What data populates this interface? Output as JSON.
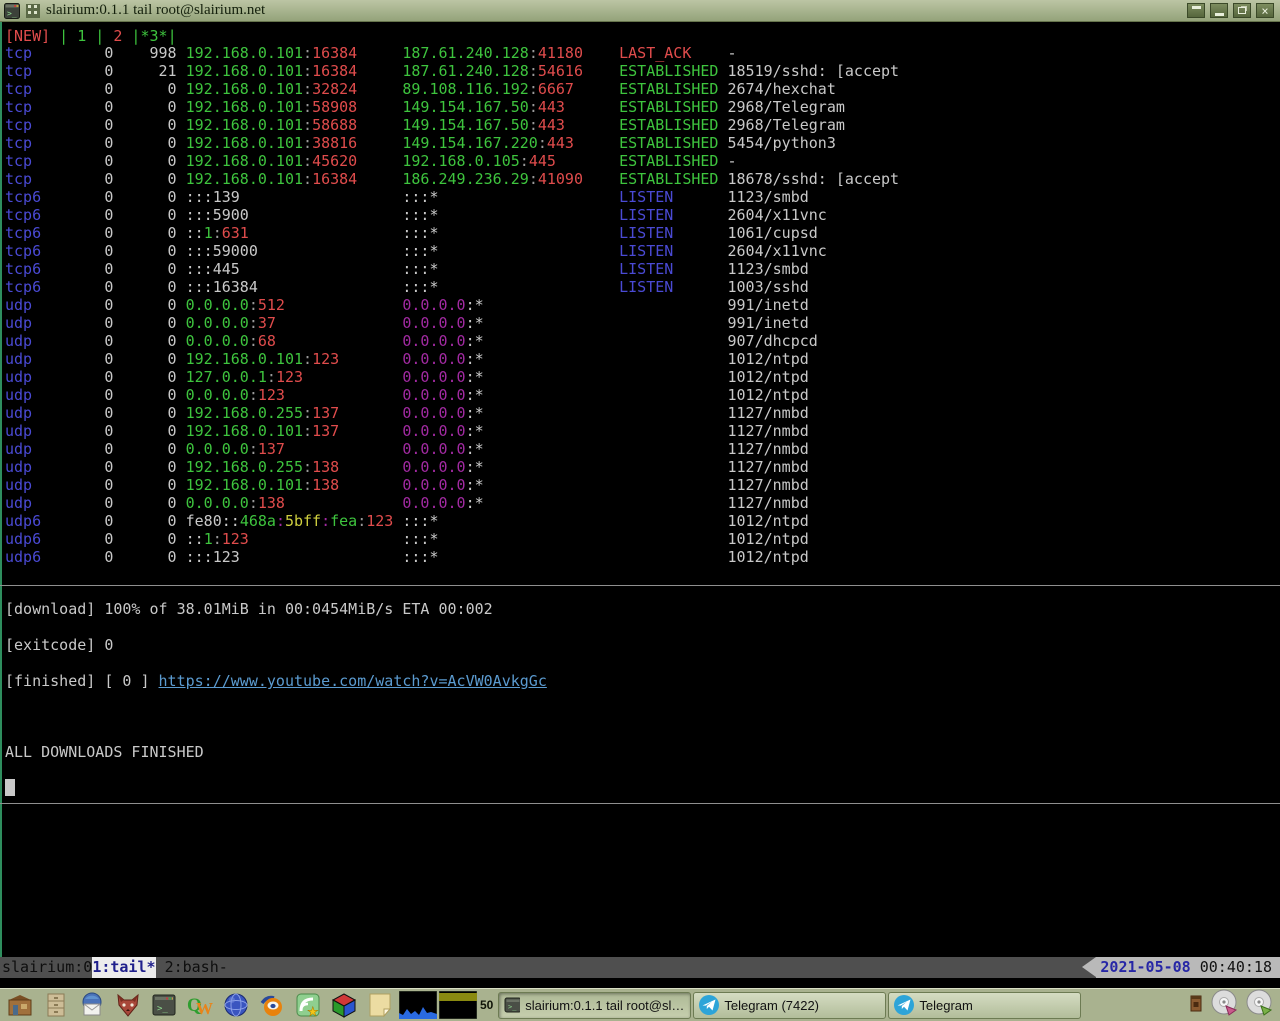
{
  "palette": {
    "blue": "#4a4ad4",
    "green": "#3ec43e",
    "red": "#e04c4c",
    "white": "#c9c9c9",
    "dim": "#9a9a9a",
    "purple": "#a22aa2",
    "yellow": "#cfcf3f",
    "link": "#5b9bd0",
    "term_bg": "#000000",
    "border_green": "#2e8e5e",
    "titlebar": "#a9b28f"
  },
  "window": {
    "title": "slairium:0.1.1 tail root@slairium.net",
    "controls": [
      {
        "name": "shade"
      },
      {
        "name": "minimize"
      },
      {
        "name": "maximize"
      },
      {
        "name": "close"
      }
    ]
  },
  "terminal": {
    "tabline": [
      {
        "t": "[NEW]",
        "c": "red"
      },
      {
        "t": " | ",
        "c": "green"
      },
      {
        "t": "1",
        "c": "green"
      },
      {
        "t": " | ",
        "c": "green"
      },
      {
        "t": "2",
        "c": "red"
      },
      {
        "t": " |",
        "c": "green"
      },
      {
        "t": "*3*",
        "c": "green"
      },
      {
        "t": "|",
        "c": "green"
      }
    ],
    "netstat": {
      "rows": [
        {
          "proto": "tcp",
          "rq": "0",
          "sq": "998",
          "local": [
            [
              "192.168.0.101",
              "green"
            ],
            [
              ":",
              "dim"
            ],
            [
              "16384",
              "red"
            ]
          ],
          "foreign": [
            [
              "187.61.240.128",
              "green"
            ],
            [
              ":",
              "dim"
            ],
            [
              "41180",
              "red"
            ]
          ],
          "state": [
            "LAST_ACK",
            "red"
          ],
          "prog": "-"
        },
        {
          "proto": "tcp",
          "rq": "0",
          "sq": "21",
          "local": [
            [
              "192.168.0.101",
              "green"
            ],
            [
              ":",
              "dim"
            ],
            [
              "16384",
              "red"
            ]
          ],
          "foreign": [
            [
              "187.61.240.128",
              "green"
            ],
            [
              ":",
              "dim"
            ],
            [
              "54616",
              "red"
            ]
          ],
          "state": [
            "ESTABLISHED",
            "green"
          ],
          "prog": "18519/sshd: [accept"
        },
        {
          "proto": "tcp",
          "rq": "0",
          "sq": "0",
          "local": [
            [
              "192.168.0.101",
              "green"
            ],
            [
              ":",
              "dim"
            ],
            [
              "32824",
              "red"
            ]
          ],
          "foreign": [
            [
              "89.108.116.192",
              "green"
            ],
            [
              ":",
              "dim"
            ],
            [
              "6667",
              "red"
            ]
          ],
          "state": [
            "ESTABLISHED",
            "green"
          ],
          "prog": "2674/hexchat"
        },
        {
          "proto": "tcp",
          "rq": "0",
          "sq": "0",
          "local": [
            [
              "192.168.0.101",
              "green"
            ],
            [
              ":",
              "dim"
            ],
            [
              "58908",
              "red"
            ]
          ],
          "foreign": [
            [
              "149.154.167.50",
              "green"
            ],
            [
              ":",
              "dim"
            ],
            [
              "443",
              "red"
            ]
          ],
          "state": [
            "ESTABLISHED",
            "green"
          ],
          "prog": "2968/Telegram"
        },
        {
          "proto": "tcp",
          "rq": "0",
          "sq": "0",
          "local": [
            [
              "192.168.0.101",
              "green"
            ],
            [
              ":",
              "dim"
            ],
            [
              "58688",
              "red"
            ]
          ],
          "foreign": [
            [
              "149.154.167.50",
              "green"
            ],
            [
              ":",
              "dim"
            ],
            [
              "443",
              "red"
            ]
          ],
          "state": [
            "ESTABLISHED",
            "green"
          ],
          "prog": "2968/Telegram"
        },
        {
          "proto": "tcp",
          "rq": "0",
          "sq": "0",
          "local": [
            [
              "192.168.0.101",
              "green"
            ],
            [
              ":",
              "dim"
            ],
            [
              "38816",
              "red"
            ]
          ],
          "foreign": [
            [
              "149.154.167.220",
              "green"
            ],
            [
              ":",
              "dim"
            ],
            [
              "443",
              "red"
            ]
          ],
          "state": [
            "ESTABLISHED",
            "green"
          ],
          "prog": "5454/python3"
        },
        {
          "proto": "tcp",
          "rq": "0",
          "sq": "0",
          "local": [
            [
              "192.168.0.101",
              "green"
            ],
            [
              ":",
              "dim"
            ],
            [
              "45620",
              "red"
            ]
          ],
          "foreign": [
            [
              "192.168.0.105",
              "green"
            ],
            [
              ":",
              "dim"
            ],
            [
              "445",
              "red"
            ]
          ],
          "state": [
            "ESTABLISHED",
            "green"
          ],
          "prog": "-"
        },
        {
          "proto": "tcp",
          "rq": "0",
          "sq": "0",
          "local": [
            [
              "192.168.0.101",
              "green"
            ],
            [
              ":",
              "dim"
            ],
            [
              "16384",
              "red"
            ]
          ],
          "foreign": [
            [
              "186.249.236.29",
              "green"
            ],
            [
              ":",
              "dim"
            ],
            [
              "41090",
              "red"
            ]
          ],
          "state": [
            "ESTABLISHED",
            "green"
          ],
          "prog": "18678/sshd: [accept"
        },
        {
          "proto": "tcp6",
          "rq": "0",
          "sq": "0",
          "local": [
            [
              ":::139",
              "white"
            ]
          ],
          "foreign": [
            [
              ":::*",
              "white"
            ]
          ],
          "state": [
            "LISTEN",
            "blue"
          ],
          "prog": "1123/smbd"
        },
        {
          "proto": "tcp6",
          "rq": "0",
          "sq": "0",
          "local": [
            [
              ":::5900",
              "white"
            ]
          ],
          "foreign": [
            [
              ":::*",
              "white"
            ]
          ],
          "state": [
            "LISTEN",
            "blue"
          ],
          "prog": "2604/x11vnc"
        },
        {
          "proto": "tcp6",
          "rq": "0",
          "sq": "0",
          "local": [
            [
              "::",
              "white"
            ],
            [
              "1",
              "green"
            ],
            [
              ":",
              "dim"
            ],
            [
              "631",
              "red"
            ]
          ],
          "foreign": [
            [
              ":::*",
              "white"
            ]
          ],
          "state": [
            "LISTEN",
            "blue"
          ],
          "prog": "1061/cupsd"
        },
        {
          "proto": "tcp6",
          "rq": "0",
          "sq": "0",
          "local": [
            [
              ":::59000",
              "white"
            ]
          ],
          "foreign": [
            [
              ":::*",
              "white"
            ]
          ],
          "state": [
            "LISTEN",
            "blue"
          ],
          "prog": "2604/x11vnc"
        },
        {
          "proto": "tcp6",
          "rq": "0",
          "sq": "0",
          "local": [
            [
              ":::445",
              "white"
            ]
          ],
          "foreign": [
            [
              ":::*",
              "white"
            ]
          ],
          "state": [
            "LISTEN",
            "blue"
          ],
          "prog": "1123/smbd"
        },
        {
          "proto": "tcp6",
          "rq": "0",
          "sq": "0",
          "local": [
            [
              ":::16384",
              "white"
            ]
          ],
          "foreign": [
            [
              ":::*",
              "white"
            ]
          ],
          "state": [
            "LISTEN",
            "blue"
          ],
          "prog": "1003/sshd"
        },
        {
          "proto": "udp",
          "rq": "0",
          "sq": "0",
          "local": [
            [
              "0.0.0.0",
              "green"
            ],
            [
              ":",
              "dim"
            ],
            [
              "512",
              "red"
            ]
          ],
          "foreign": [
            [
              "0.0.0.0",
              "purple"
            ],
            [
              ":*",
              "white"
            ]
          ],
          "state": null,
          "prog": "991/inetd"
        },
        {
          "proto": "udp",
          "rq": "0",
          "sq": "0",
          "local": [
            [
              "0.0.0.0",
              "green"
            ],
            [
              ":",
              "dim"
            ],
            [
              "37",
              "red"
            ]
          ],
          "foreign": [
            [
              "0.0.0.0",
              "purple"
            ],
            [
              ":*",
              "white"
            ]
          ],
          "state": null,
          "prog": "991/inetd"
        },
        {
          "proto": "udp",
          "rq": "0",
          "sq": "0",
          "local": [
            [
              "0.0.0.0",
              "green"
            ],
            [
              ":",
              "dim"
            ],
            [
              "68",
              "red"
            ]
          ],
          "foreign": [
            [
              "0.0.0.0",
              "purple"
            ],
            [
              ":*",
              "white"
            ]
          ],
          "state": null,
          "prog": "907/dhcpcd"
        },
        {
          "proto": "udp",
          "rq": "0",
          "sq": "0",
          "local": [
            [
              "192.168.0.101",
              "green"
            ],
            [
              ":",
              "dim"
            ],
            [
              "123",
              "red"
            ]
          ],
          "foreign": [
            [
              "0.0.0.0",
              "purple"
            ],
            [
              ":*",
              "white"
            ]
          ],
          "state": null,
          "prog": "1012/ntpd"
        },
        {
          "proto": "udp",
          "rq": "0",
          "sq": "0",
          "local": [
            [
              "127.0.0.1",
              "green"
            ],
            [
              ":",
              "dim"
            ],
            [
              "123",
              "red"
            ]
          ],
          "foreign": [
            [
              "0.0.0.0",
              "purple"
            ],
            [
              ":*",
              "white"
            ]
          ],
          "state": null,
          "prog": "1012/ntpd"
        },
        {
          "proto": "udp",
          "rq": "0",
          "sq": "0",
          "local": [
            [
              "0.0.0.0",
              "green"
            ],
            [
              ":",
              "dim"
            ],
            [
              "123",
              "red"
            ]
          ],
          "foreign": [
            [
              "0.0.0.0",
              "purple"
            ],
            [
              ":*",
              "white"
            ]
          ],
          "state": null,
          "prog": "1012/ntpd"
        },
        {
          "proto": "udp",
          "rq": "0",
          "sq": "0",
          "local": [
            [
              "192.168.0.255",
              "green"
            ],
            [
              ":",
              "dim"
            ],
            [
              "137",
              "red"
            ]
          ],
          "foreign": [
            [
              "0.0.0.0",
              "purple"
            ],
            [
              ":*",
              "white"
            ]
          ],
          "state": null,
          "prog": "1127/nmbd"
        },
        {
          "proto": "udp",
          "rq": "0",
          "sq": "0",
          "local": [
            [
              "192.168.0.101",
              "green"
            ],
            [
              ":",
              "dim"
            ],
            [
              "137",
              "red"
            ]
          ],
          "foreign": [
            [
              "0.0.0.0",
              "purple"
            ],
            [
              ":*",
              "white"
            ]
          ],
          "state": null,
          "prog": "1127/nmbd"
        },
        {
          "proto": "udp",
          "rq": "0",
          "sq": "0",
          "local": [
            [
              "0.0.0.0",
              "green"
            ],
            [
              ":",
              "dim"
            ],
            [
              "137",
              "red"
            ]
          ],
          "foreign": [
            [
              "0.0.0.0",
              "purple"
            ],
            [
              ":*",
              "white"
            ]
          ],
          "state": null,
          "prog": "1127/nmbd"
        },
        {
          "proto": "udp",
          "rq": "0",
          "sq": "0",
          "local": [
            [
              "192.168.0.255",
              "green"
            ],
            [
              ":",
              "dim"
            ],
            [
              "138",
              "red"
            ]
          ],
          "foreign": [
            [
              "0.0.0.0",
              "purple"
            ],
            [
              ":*",
              "white"
            ]
          ],
          "state": null,
          "prog": "1127/nmbd"
        },
        {
          "proto": "udp",
          "rq": "0",
          "sq": "0",
          "local": [
            [
              "192.168.0.101",
              "green"
            ],
            [
              ":",
              "dim"
            ],
            [
              "138",
              "red"
            ]
          ],
          "foreign": [
            [
              "0.0.0.0",
              "purple"
            ],
            [
              ":*",
              "white"
            ]
          ],
          "state": null,
          "prog": "1127/nmbd"
        },
        {
          "proto": "udp",
          "rq": "0",
          "sq": "0",
          "local": [
            [
              "0.0.0.0",
              "green"
            ],
            [
              ":",
              "dim"
            ],
            [
              "138",
              "red"
            ]
          ],
          "foreign": [
            [
              "0.0.0.0",
              "purple"
            ],
            [
              ":*",
              "white"
            ]
          ],
          "state": null,
          "prog": "1127/nmbd"
        },
        {
          "proto": "udp6",
          "rq": "0",
          "sq": "0",
          "local": [
            [
              "fe80::",
              "white"
            ],
            [
              "468a",
              "green"
            ],
            [
              ":",
              "purple"
            ],
            [
              "5bff",
              "yellow"
            ],
            [
              ":",
              "purple"
            ],
            [
              "fea",
              "green"
            ],
            [
              ":",
              "dim"
            ],
            [
              "123",
              "red"
            ]
          ],
          "foreign": [
            [
              ":::*",
              "white"
            ]
          ],
          "state": null,
          "prog": "1012/ntpd"
        },
        {
          "proto": "udp6",
          "rq": "0",
          "sq": "0",
          "local": [
            [
              "::",
              "white"
            ],
            [
              "1",
              "green"
            ],
            [
              ":",
              "dim"
            ],
            [
              "123",
              "red"
            ]
          ],
          "foreign": [
            [
              ":::*",
              "white"
            ]
          ],
          "state": null,
          "prog": "1012/ntpd"
        },
        {
          "proto": "udp6",
          "rq": "0",
          "sq": "0",
          "local": [
            [
              ":::123",
              "white"
            ]
          ],
          "foreign": [
            [
              ":::*",
              "white"
            ]
          ],
          "state": null,
          "prog": "1012/ntpd"
        }
      ]
    },
    "download_line": "[download] 100% of 38.01MiB in 00:0454MiB/s ETA 00:002",
    "exitcode_line": "[exitcode] 0",
    "finished_line": [
      {
        "t": "[finished] [ 0 ] ",
        "c": "white"
      },
      {
        "t": "https://www.youtube.com/watch?v=AcVW0AvkgGc",
        "c": "link",
        "u": 1,
        "name": "youtube-link",
        "i": 1
      }
    ],
    "all_finished_line": "ALL DOWNLOADS FINISHED"
  },
  "tmuxbar": {
    "session": "slairium:0",
    "active_window": "1:tail*",
    "other_window": "2:bash-",
    "date": "2021-05-08",
    "time": "00:40:18"
  },
  "taskbar": {
    "launchers": [
      {
        "name": "home-icon"
      },
      {
        "name": "file-cabinet-icon"
      },
      {
        "name": "email-icon"
      },
      {
        "name": "fox-icon"
      },
      {
        "name": "terminal-icon"
      },
      {
        "name": "writer-icon"
      },
      {
        "name": "globe-icon"
      },
      {
        "name": "blender-icon"
      },
      {
        "name": "feed-reader-icon"
      },
      {
        "name": "color-cube-icon"
      },
      {
        "name": "notes-icon"
      }
    ],
    "monitor_label": "50",
    "buttons": [
      {
        "label": "slairium:0.1.1 tail root@slairiu...",
        "icon": "terminal-icon",
        "active": true
      },
      {
        "label": "Telegram (7422)",
        "icon": "telegram-icon",
        "active": false
      },
      {
        "label": "Telegram",
        "icon": "telegram-icon",
        "active": false
      }
    ],
    "tray": [
      {
        "name": "package-icon"
      },
      {
        "name": "disk-eject-icon"
      },
      {
        "name": "disk-insert-icon"
      }
    ]
  }
}
